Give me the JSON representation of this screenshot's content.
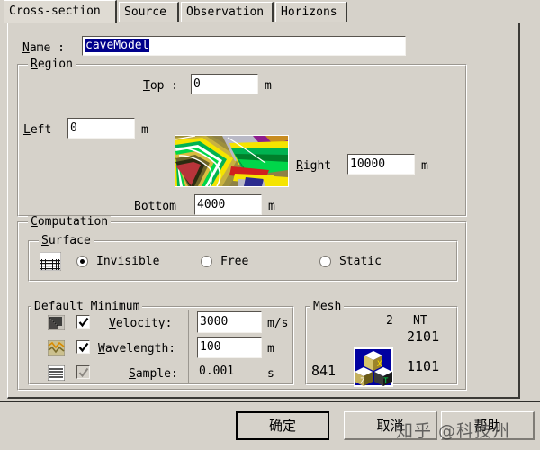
{
  "window": {
    "background_color": "#d6d2ca",
    "accent_selection_color": "#00008b"
  },
  "tabs": [
    {
      "label": "Cross-section",
      "selected": true
    },
    {
      "label": "Source",
      "selected": false
    },
    {
      "label": "Observation",
      "selected": false
    },
    {
      "label": "Horizons",
      "selected": false
    }
  ],
  "name_row": {
    "label": "Name :",
    "value": "caveModel",
    "selected": true
  },
  "region": {
    "title": "Region",
    "top": {
      "label": "Top :",
      "value": "0",
      "unit": "m"
    },
    "left": {
      "label": "Left",
      "value": "0",
      "unit": "m"
    },
    "right": {
      "label": "Right",
      "value": "10000",
      "unit": "m"
    },
    "bottom": {
      "label": "Bottom",
      "value": "4000",
      "unit": "m"
    },
    "preview_icon": "geological-cross-section-preview"
  },
  "computation": {
    "title": "Computation",
    "surface": {
      "title": "Surface",
      "icon": "surface-hatch-icon",
      "options": [
        {
          "label": "Invisible",
          "checked": true
        },
        {
          "label": "Free",
          "checked": false
        },
        {
          "label": "Static",
          "checked": false
        }
      ]
    },
    "default_minimum": {
      "title": "Default Minimum",
      "rows": [
        {
          "icon": "velocity-contour-icon",
          "checked": true,
          "enabled": true,
          "label": "Velocity:",
          "value": "3000",
          "unit": "m/s"
        },
        {
          "icon": "wavelength-wave-icon",
          "checked": true,
          "enabled": true,
          "label": "Wavelength:",
          "value": "100",
          "unit": "m"
        },
        {
          "icon": "sample-lines-icon",
          "checked": true,
          "enabled": false,
          "label": "Sample:",
          "value": "0.001",
          "unit": "s"
        }
      ]
    },
    "mesh": {
      "title": "Mesh",
      "icon": "axis-cube-icon",
      "nt_label": "NT",
      "dim_value": "2",
      "nt_value": "2101",
      "nz_value": "1101",
      "nx_value": "841"
    }
  },
  "buttons": [
    {
      "label": "确定",
      "default": true
    },
    {
      "label": "取消",
      "default": false
    },
    {
      "label": "帮助",
      "default": false
    }
  ],
  "watermark": {
    "text": "知乎 @科技州"
  }
}
